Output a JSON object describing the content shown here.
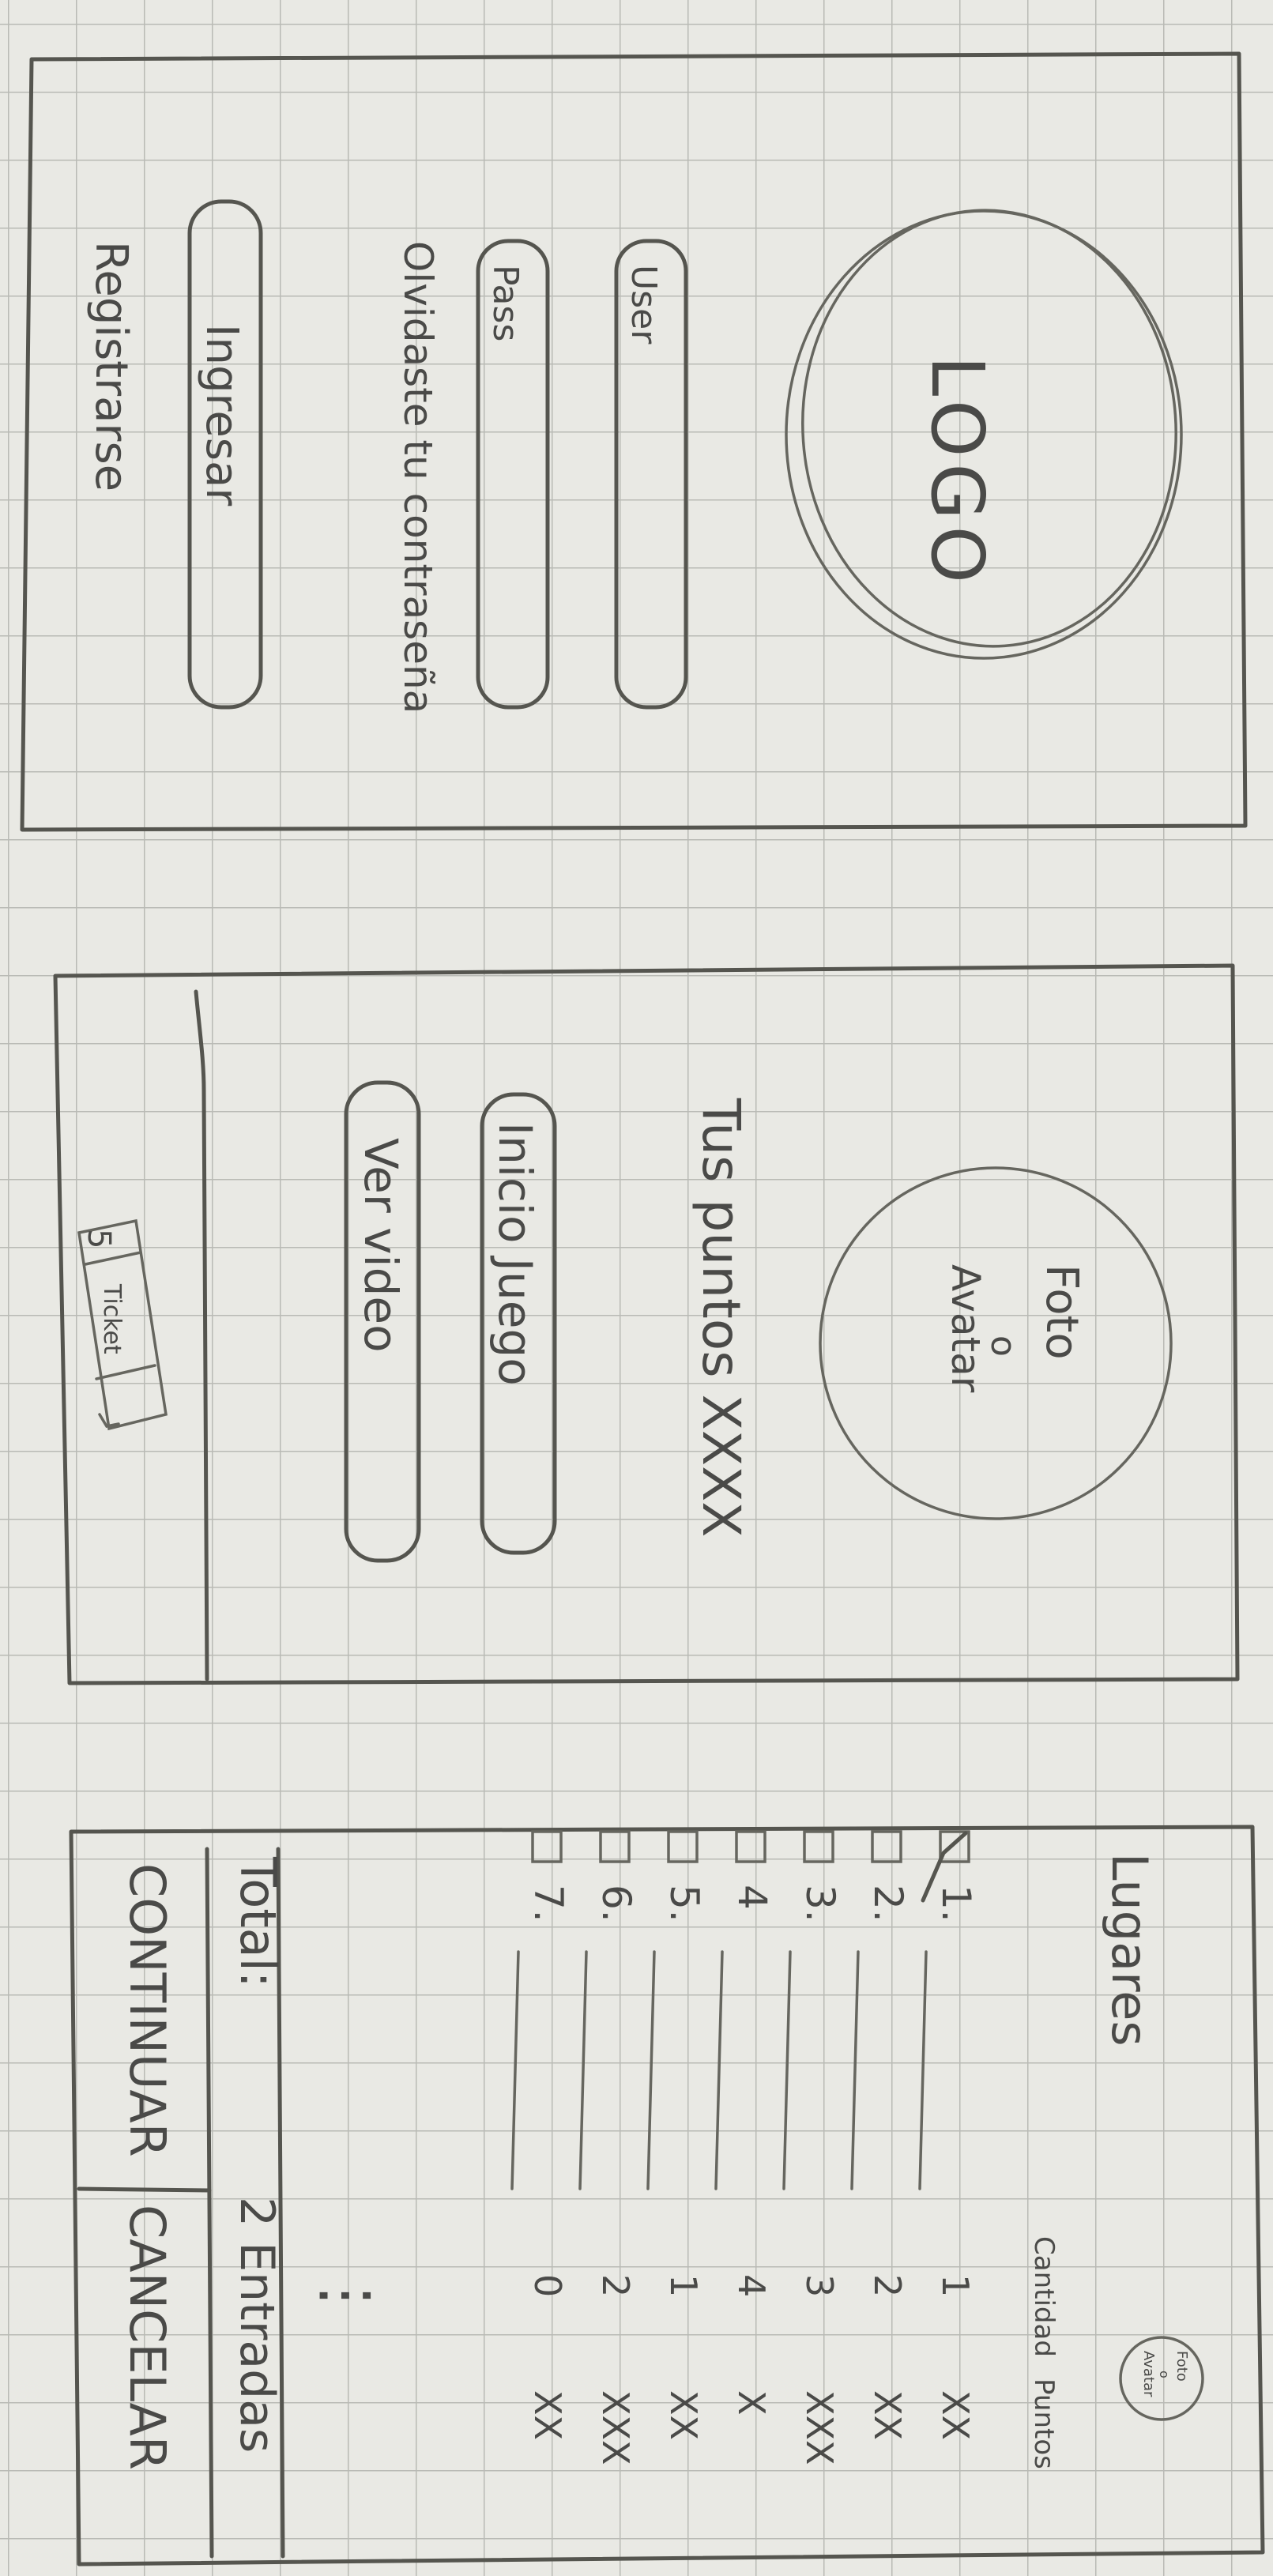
{
  "login": {
    "logo": "LOGO",
    "user_placeholder": "User",
    "pass_placeholder": "Pass",
    "forgot": "Olvidaste tu contraseña",
    "login_button": "Ingresar",
    "register": "Registrarse"
  },
  "home": {
    "avatar_line1": "Foto",
    "avatar_line2": "o",
    "avatar_line3": "Avatar",
    "points": "Tus puntos XXXX",
    "start_game_button": "Inicio Juego",
    "watch_video_button": "Ver video",
    "ticket_count": "5",
    "ticket_label": "Ticket"
  },
  "places": {
    "title": "Lugares",
    "avatar_line1": "Foto",
    "avatar_line2": "o",
    "avatar_line3": "Avatar",
    "column_qty": "Cantidad",
    "column_points": "Puntos",
    "rows": [
      {
        "label": "1.",
        "qty": "1",
        "points": "XX",
        "checked": true
      },
      {
        "label": "2.",
        "qty": "2",
        "points": "XX",
        "checked": false
      },
      {
        "label": "3.",
        "qty": "3",
        "points": "XXX",
        "checked": false
      },
      {
        "label": "4",
        "qty": "4",
        "points": "X",
        "checked": false
      },
      {
        "label": "5.",
        "qty": "1",
        "points": "XX",
        "checked": false
      },
      {
        "label": "6.",
        "qty": "2",
        "points": "XXX",
        "checked": false
      },
      {
        "label": "7.",
        "qty": "0",
        "points": "XX",
        "checked": false
      }
    ],
    "ellipsis": "⋮",
    "total_label": "Total:",
    "total_value": "2 Entradas",
    "continue_button": "CONTINUAR",
    "cancel_button": "CANCELAR"
  }
}
